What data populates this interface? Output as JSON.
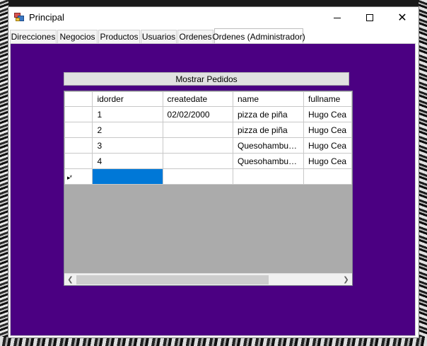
{
  "window": {
    "title": "Principal",
    "app_icon": "windows-forms-app-icon"
  },
  "caption_buttons": {
    "minimize_icon": "minimize-icon",
    "maximize_icon": "maximize-icon",
    "close_icon": "close-icon",
    "close_glyph": "✕"
  },
  "tabs": [
    {
      "label": "Direcciones"
    },
    {
      "label": "Negocios"
    },
    {
      "label": "Productos"
    },
    {
      "label": "Usuarios"
    },
    {
      "label": "Ordenes"
    },
    {
      "label": "Ordenes (Administrador)",
      "active": true
    }
  ],
  "panel": {
    "background": "#4b0082",
    "show_button_label": "Mostrar Pedidos"
  },
  "grid": {
    "columns": [
      "idorder",
      "createdate",
      "name",
      "fullname"
    ],
    "rows": [
      {
        "idorder": "1",
        "createdate": "02/02/2000",
        "name": "pizza de piña",
        "fullname": "Hugo Cea"
      },
      {
        "idorder": "2",
        "createdate": "",
        "name": "pizza de piña",
        "fullname": "Hugo Cea"
      },
      {
        "idorder": "3",
        "createdate": "",
        "name": "Quesohamburgu...",
        "fullname": "Hugo Cea"
      },
      {
        "idorder": "4",
        "createdate": "",
        "name": "Quesohamburgu...",
        "fullname": "Hugo Cea"
      }
    ],
    "new_row_marker": "▸*",
    "selection_color": "#0078d7",
    "empty_area_color": "#ababab"
  }
}
